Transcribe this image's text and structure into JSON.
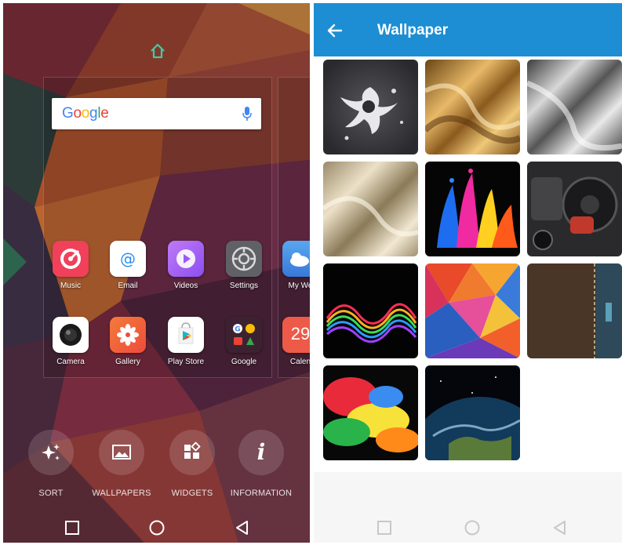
{
  "launcher": {
    "search": {
      "logo_text": "Google"
    },
    "apps": [
      {
        "label": "Music",
        "icon": "music-icon",
        "color": "#f0405a"
      },
      {
        "label": "Email",
        "icon": "email-icon",
        "color": "#ffffff"
      },
      {
        "label": "Videos",
        "icon": "videos-icon",
        "color": "#a35cf0"
      },
      {
        "label": "Settings",
        "icon": "settings-icon",
        "color": "#5f6166"
      },
      {
        "label": "Camera",
        "icon": "camera-icon",
        "color": "#ffffff"
      },
      {
        "label": "Gallery",
        "icon": "gallery-icon",
        "color": "#f0623c"
      },
      {
        "label": "Play Store",
        "icon": "play-store-icon",
        "color": "#ffffff"
      },
      {
        "label": "Google",
        "icon": "google-folder-icon",
        "color": "#4a2a38"
      }
    ],
    "next_page_apps": [
      {
        "label": "My We",
        "icon": "weather-icon"
      },
      {
        "label": "Calen",
        "icon": "calendar-icon",
        "day": "29"
      }
    ],
    "actions": [
      {
        "label": "SORT",
        "icon": "sparkle-icon"
      },
      {
        "label": "WALLPAPERS",
        "icon": "image-icon"
      },
      {
        "label": "WIDGETS",
        "icon": "widgets-icon"
      },
      {
        "label": "INFORMATION",
        "icon": "info-icon"
      }
    ]
  },
  "wallpaper_picker": {
    "title": "Wallpaper",
    "back_icon": "arrow-left-icon",
    "accent": "#1d8ed3",
    "thumbnails": [
      {
        "name": "black-silver-splash"
      },
      {
        "name": "gold-silk"
      },
      {
        "name": "silver-silk"
      },
      {
        "name": "champagne-silk"
      },
      {
        "name": "color-paint-splash"
      },
      {
        "name": "car-interior"
      },
      {
        "name": "rainbow-smoke"
      },
      {
        "name": "low-poly-colors"
      },
      {
        "name": "leather-denim"
      },
      {
        "name": "color-powder-explosion"
      },
      {
        "name": "earth-from-space"
      }
    ]
  }
}
